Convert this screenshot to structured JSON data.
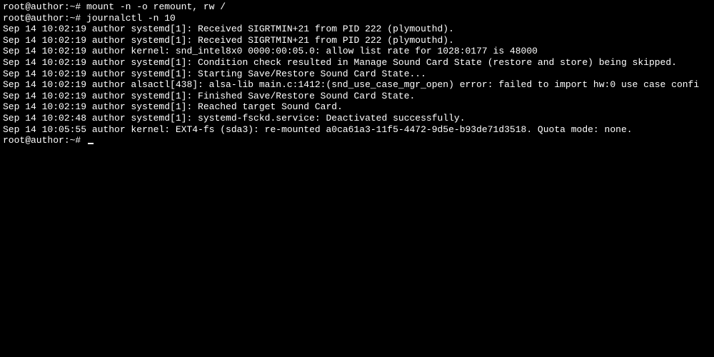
{
  "prompt": "root@author:~# ",
  "cmd1": "mount -n -o remount, rw /",
  "cmd2": "journalctl -n 10",
  "log": [
    "Sep 14 10:02:19 author systemd[1]: Received SIGRTMIN+21 from PID 222 (plymouthd).",
    "Sep 14 10:02:19 author systemd[1]: Received SIGRTMIN+21 from PID 222 (plymouthd).",
    "Sep 14 10:02:19 author kernel: snd_intel8x0 0000:00:05.0: allow list rate for 1028:0177 is 48000",
    "Sep 14 10:02:19 author systemd[1]: Condition check resulted in Manage Sound Card State (restore and store) being skipped.",
    "Sep 14 10:02:19 author systemd[1]: Starting Save/Restore Sound Card State...",
    "Sep 14 10:02:19 author alsactl[438]: alsa-lib main.c:1412:(snd_use_case_mgr_open) error: failed to import hw:0 use case confi",
    "Sep 14 10:02:19 author systemd[1]: Finished Save/Restore Sound Card State.",
    "Sep 14 10:02:19 author systemd[1]: Reached target Sound Card.",
    "Sep 14 10:02:48 author systemd[1]: systemd-fsckd.service: Deactivated successfully.",
    "Sep 14 10:05:55 author kernel: EXT4-fs (sda3): re-mounted a0ca61a3-11f5-4472-9d5e-b93de71d3518. Quota mode: none."
  ]
}
